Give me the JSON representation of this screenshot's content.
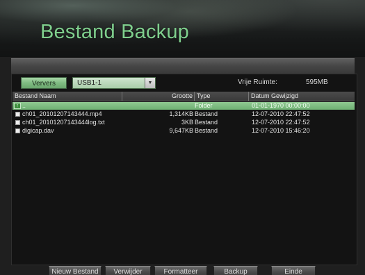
{
  "header": {
    "title": "Bestand Backup"
  },
  "toolbar": {
    "refresh_label": "Ververs",
    "device_selected": "USB1-1",
    "free_space_label": "Vrije Ruimte:",
    "free_space_value": "595MB"
  },
  "table": {
    "columns": [
      "Bestand Naam",
      "Grootte",
      "Type",
      "Datum Gewijzigd"
    ],
    "rows": [
      {
        "name": "..",
        "size": "",
        "type": "Folder",
        "date": "01-01-1970 00:00:00",
        "icon": "folder-up-icon",
        "selected": true
      },
      {
        "name": "ch01_20101207143444.mp4",
        "size": "1,314KB",
        "type": "Bestand",
        "date": "12-07-2010 22:47:52",
        "icon": "file-icon",
        "selected": false
      },
      {
        "name": "ch01_20101207143444log.txt",
        "size": "3KB",
        "type": "Bestand",
        "date": "12-07-2010 22:47:52",
        "icon": "file-icon",
        "selected": false
      },
      {
        "name": "digicap.dav",
        "size": "9,647KB",
        "type": "Bestand",
        "date": "12-07-2010 15:46:20",
        "icon": "file-icon",
        "selected": false
      }
    ]
  },
  "buttons": {
    "new_folder": "Nieuw Bestand",
    "delete": "Verwijder",
    "format": "Formatteer",
    "backup": "Backup",
    "exit": "Einde"
  },
  "colors": {
    "accent": "#7fcf8d",
    "selected_row": "#7fbd82"
  }
}
